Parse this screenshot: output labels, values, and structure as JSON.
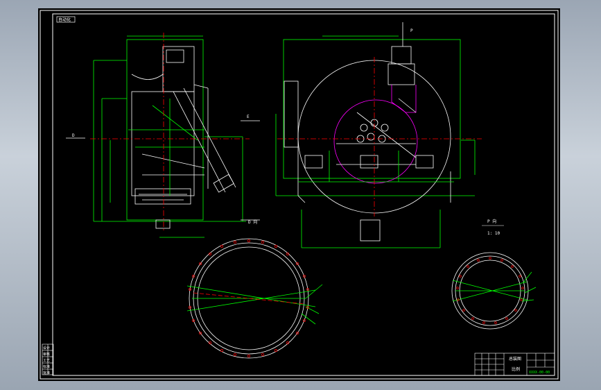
{
  "drawing": {
    "top_left_tag": "自动化",
    "section_D_left": "D",
    "section_E": "E",
    "section_E_right": "E",
    "section_P": "P",
    "view_D_title": "D 向",
    "view_P_title": "P 向",
    "view_P_scale": "1: 10",
    "title_block": {
      "main_label": "总装图",
      "sub_label": "比例",
      "right_label": "XXXX-00-00"
    },
    "revision_block": [
      "设计",
      "审核",
      "工艺",
      "标准",
      "批准"
    ]
  },
  "colors": {
    "background": "#000000",
    "border": "#ffffff",
    "dimension": "#00ff00",
    "centerline": "#ff0000",
    "accent": "#ff00ff",
    "frame": "#9aa5b2"
  }
}
